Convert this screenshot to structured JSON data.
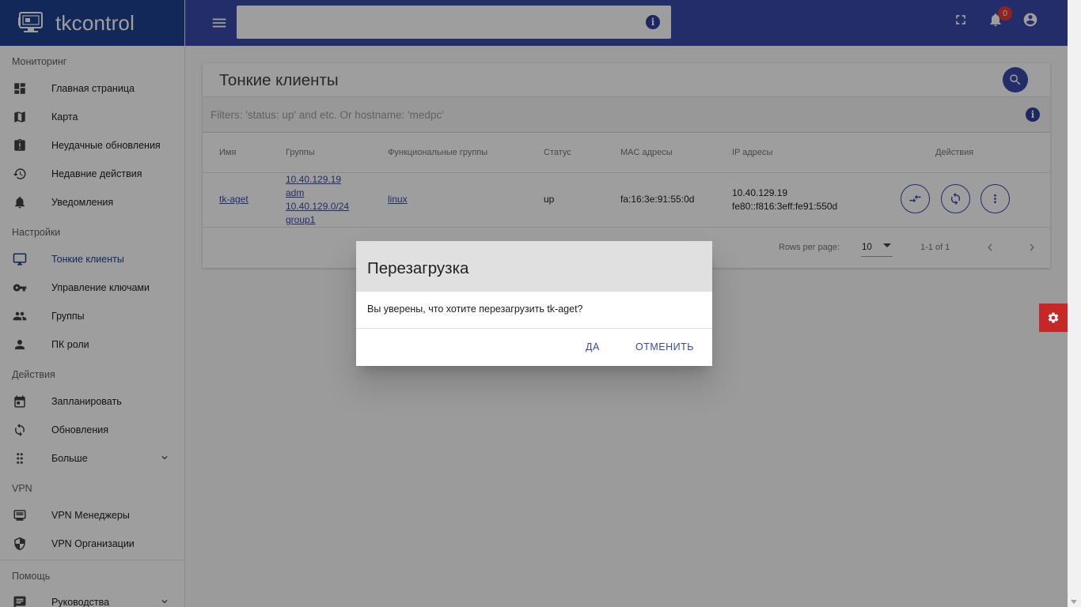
{
  "brand": {
    "name": "tkcontrol"
  },
  "sidebar": {
    "sections": [
      {
        "title": "Мониторинг",
        "items": [
          {
            "label": "Главная страница",
            "icon": "dashboard-icon"
          },
          {
            "label": "Карта",
            "icon": "map-icon"
          },
          {
            "label": "Неудачные обновления",
            "icon": "failed-update-icon"
          },
          {
            "label": "Недавние действия",
            "icon": "history-icon"
          },
          {
            "label": "Уведомления",
            "icon": "bell-icon"
          }
        ]
      },
      {
        "title": "Настройки",
        "items": [
          {
            "label": "Тонкие клиенты",
            "icon": "monitor-icon",
            "active": true
          },
          {
            "label": "Управление ключами",
            "icon": "key-icon"
          },
          {
            "label": "Группы",
            "icon": "people-icon"
          },
          {
            "label": "ПК роли",
            "icon": "person-icon"
          }
        ]
      },
      {
        "title": "Действия",
        "items": [
          {
            "label": "Запланировать",
            "icon": "calendar-icon"
          },
          {
            "label": "Обновления",
            "icon": "sync-icon"
          },
          {
            "label": "Больше",
            "icon": "dots-grid-icon"
          }
        ]
      },
      {
        "title": "VPN",
        "items": [
          {
            "label": "VPN Менеджеры",
            "icon": "list-icon"
          },
          {
            "label": "VPN Организации",
            "icon": "shield-icon"
          }
        ]
      },
      {
        "title": "Помощь",
        "items": [
          {
            "label": "Руководства",
            "icon": "book-icon"
          }
        ]
      }
    ]
  },
  "topbar": {
    "search_value": "",
    "notifications_count": "0"
  },
  "card": {
    "title": "Тонкие клиенты",
    "filter_placeholder": "Filters: 'status: up' and etc. Or hostname: 'medpc'"
  },
  "table": {
    "headers": [
      "Имя",
      "Группы",
      "Функциональные группы",
      "Статус",
      "MAC адресы",
      "IP адресы",
      "Действия"
    ],
    "rows": [
      {
        "name": "tk-aget",
        "groups": [
          "10.40.129.19",
          "adm",
          "10.40.129.0/24",
          "group1"
        ],
        "func_group": "linux",
        "status": "up",
        "mac": "fa:16:3e:91:55:0d",
        "ips": [
          "10.40.129.19",
          "fe80::f816:3eff:fe91:550d"
        ]
      }
    ],
    "footer": {
      "rows_per_page_label": "Rows per page:",
      "rows_per_page_value": "10",
      "range": "1-1 of 1"
    }
  },
  "dialog": {
    "title": "Перезагрузка",
    "message": "Вы уверены, что хотите перезагрузить tk-aget?",
    "confirm_label": "Да",
    "cancel_label": "Отменить"
  },
  "colors": {
    "brand": "#1e4290",
    "topbar": "#3949ab",
    "accent": "#3949ab",
    "fab": "#c62828",
    "badge": "#e53935"
  }
}
